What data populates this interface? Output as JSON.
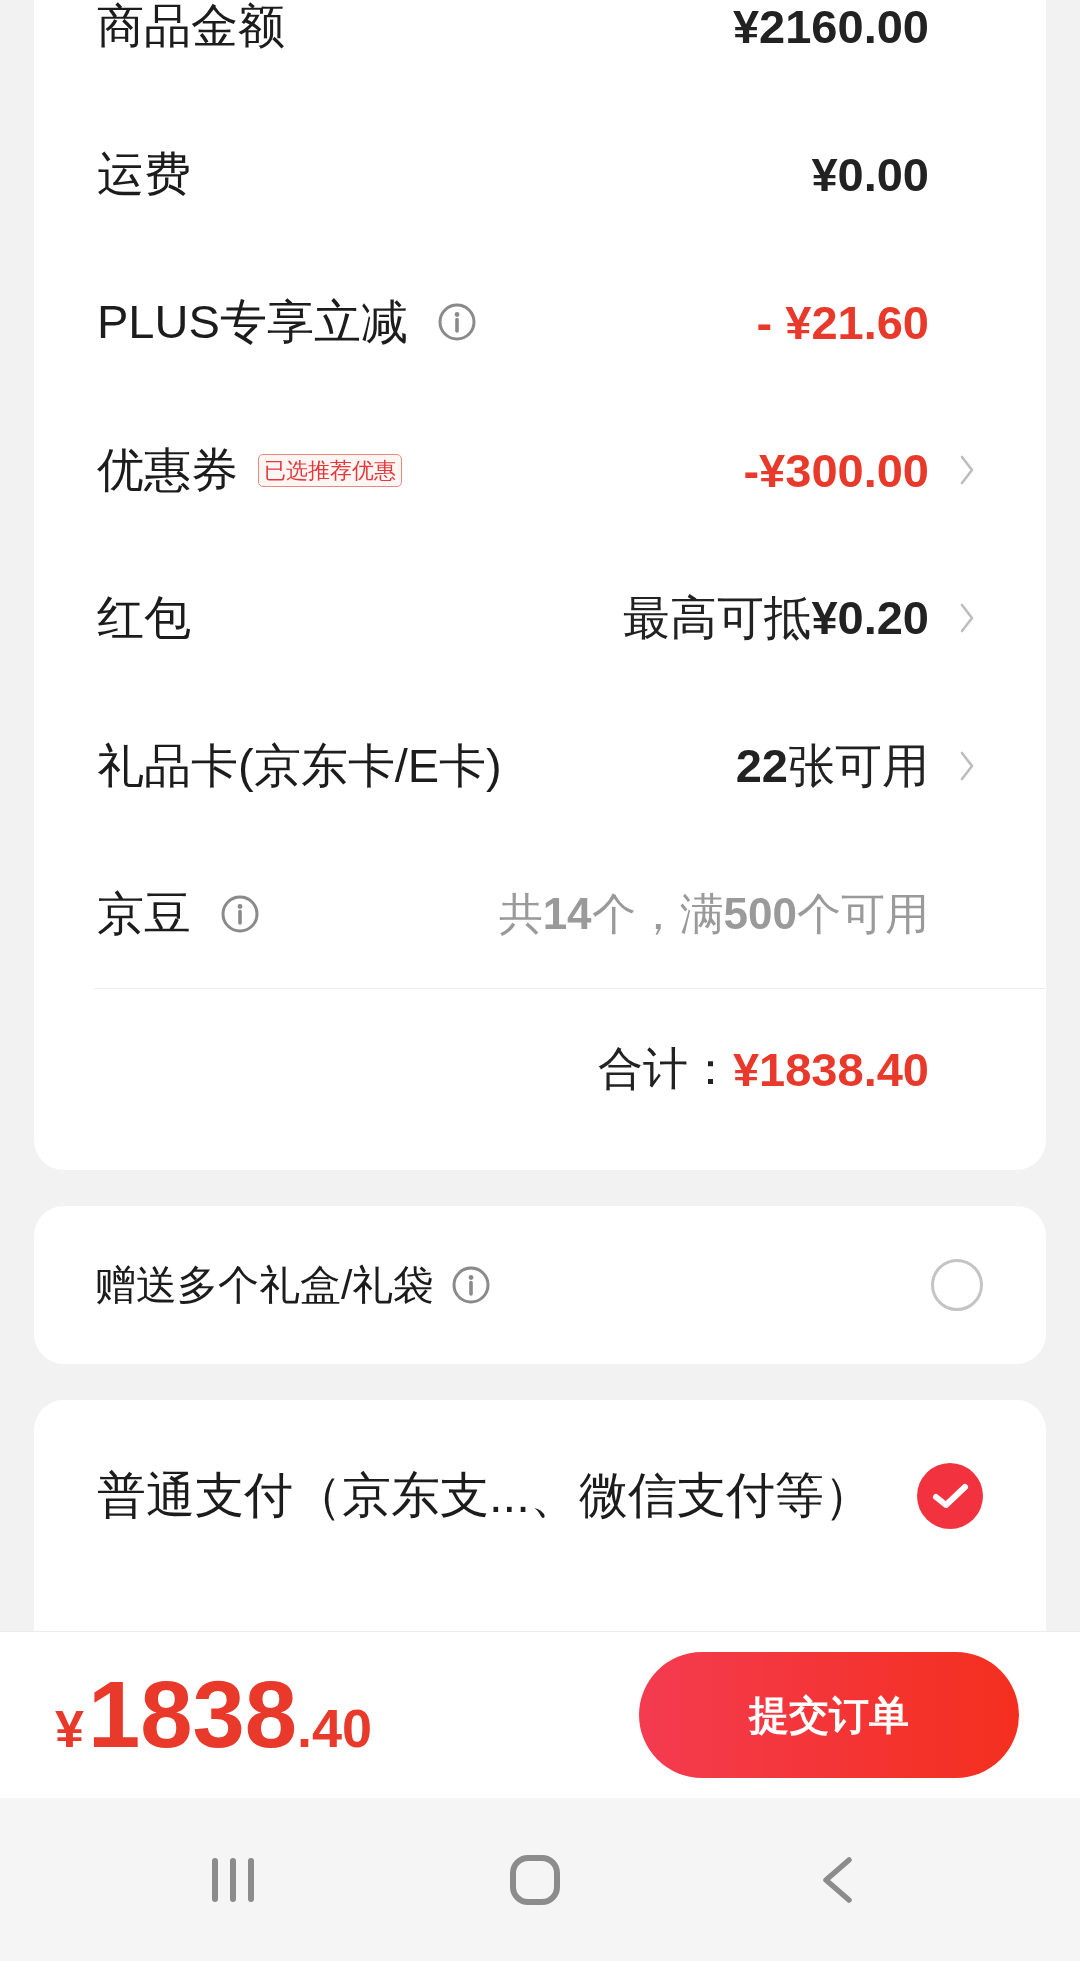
{
  "summary": {
    "rows": [
      {
        "kind": "amount",
        "label": "商品金额",
        "info": false,
        "value": "¥2160.00",
        "chevron": false
      },
      {
        "kind": "amount",
        "label": "运费",
        "info": false,
        "value": "¥0.00",
        "chevron": false
      },
      {
        "kind": "discount",
        "label": "PLUS专享立减",
        "info": true,
        "value": "- ¥21.60",
        "chevron": false
      },
      {
        "kind": "discount",
        "label": "优惠券",
        "info": false,
        "tag": "已选推荐优惠",
        "value": "-¥300.00",
        "chevron": true
      },
      {
        "kind": "option",
        "label": "红包",
        "info": false,
        "value": "最高可抵**¥0.20**",
        "chevron": true
      },
      {
        "kind": "option",
        "label": "礼品卡(京东卡/E卡)",
        "info": false,
        "value": "**22**张可用",
        "chevron": true
      },
      {
        "kind": "note",
        "label": "京豆",
        "info": true,
        "value": "共**14**个，满**500**个可用",
        "chevron": false
      }
    ],
    "total": {
      "label": "合计：",
      "amount": "¥1838.40"
    }
  },
  "gift_wrap": {
    "label": "赠送多个礼盒/礼袋",
    "info": true,
    "checked": false
  },
  "payment_options": [
    {
      "label": "普通支付（京东支...、微信支付等）",
      "selected": true
    }
  ],
  "bottom_bar": {
    "total": {
      "currency": "¥",
      "integer": "1838",
      "decimal": ".40"
    },
    "submit_button": "提交订单"
  }
}
